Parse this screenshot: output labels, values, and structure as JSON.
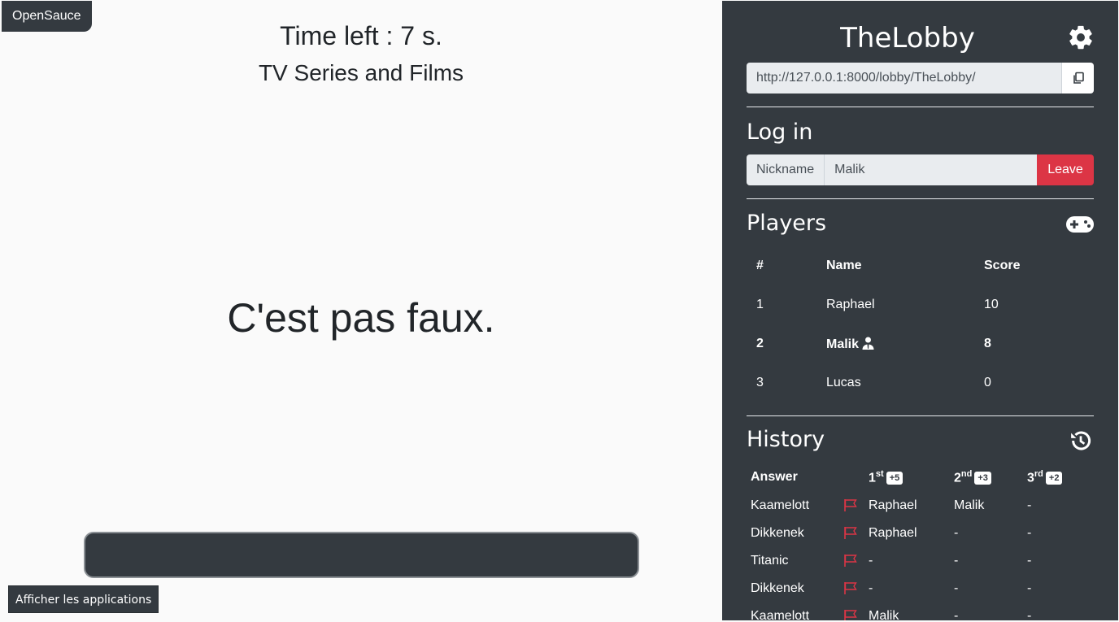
{
  "brand": "OpenSauce",
  "game": {
    "time_left": "Time left : 7 s.",
    "category": "TV Series and Films",
    "quote": "C'est pas faux.",
    "answer_value": ""
  },
  "taskbar": {
    "show_apps": "Afficher les applications"
  },
  "sidebar": {
    "lobby_name": "TheLobby",
    "url": "http://127.0.0.1:8000/lobby/TheLobby/",
    "login": {
      "title": "Log in",
      "nickname_label": "Nickname",
      "nickname_value": "Malik",
      "leave_label": "Leave"
    },
    "players": {
      "title": "Players",
      "headers": {
        "num": "#",
        "name": "Name",
        "score": "Score"
      },
      "rows": [
        {
          "num": "1",
          "name": "Raphael",
          "score": "10"
        },
        {
          "num": "2",
          "name": "Malik",
          "score": "8"
        },
        {
          "num": "3",
          "name": "Lucas",
          "score": "0"
        }
      ]
    },
    "history": {
      "title": "History",
      "headers": {
        "answer": "Answer",
        "first": "1",
        "first_sup": "st",
        "first_pts": "+5",
        "second": "2",
        "second_sup": "nd",
        "second_pts": "+3",
        "third": "3",
        "third_sup": "rd",
        "third_pts": "+2"
      },
      "rows": [
        {
          "answer": "Kaamelott",
          "first": "Raphael",
          "second": "Malik",
          "third": "-"
        },
        {
          "answer": "Dikkenek",
          "first": "Raphael",
          "second": "-",
          "third": "-"
        },
        {
          "answer": "Titanic",
          "first": "-",
          "second": "-",
          "third": "-"
        },
        {
          "answer": "Dikkenek",
          "first": "-",
          "second": "-",
          "third": "-"
        },
        {
          "answer": "Kaamelott",
          "first": "Malik",
          "second": "-",
          "third": "-"
        }
      ]
    }
  },
  "colors": {
    "sidebar_bg": "#343a40",
    "leave_red": "#dc3545",
    "flag_red": "#dc3545",
    "page_bg": "#fafafa"
  },
  "icons": [
    "gear-icon",
    "copy-icon",
    "gamepad-icon",
    "user-tie-icon",
    "history-icon",
    "flag-icon"
  ]
}
